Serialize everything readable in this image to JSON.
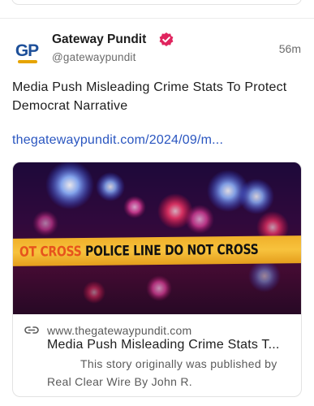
{
  "post": {
    "author": {
      "name": "Gateway Pundit",
      "handle": "@gatewaypundit",
      "avatar_text": "GP",
      "verified_icon": "verified-badge-icon"
    },
    "time": "56m",
    "text": "Media Push Misleading Crime Stats To Protect Democrat Narrative",
    "link_text": "thegatewaypundit.com/2024/09/m..."
  },
  "link_card": {
    "image_text_faded": "OT CROSS",
    "image_text": "POLICE LINE DO NOT CROSS",
    "link_icon": "link-icon",
    "domain": "www.thegatewaypundit.com",
    "title": "Media Push Misleading Crime Stats T...",
    "description_line1": "This story originally was published by",
    "description_line2": "Real Clear Wire By John R."
  },
  "colors": {
    "link": "#2a56c0",
    "verified": "#e0245e",
    "avatar_blue": "#1d4f99",
    "avatar_gold": "#e6a400"
  }
}
